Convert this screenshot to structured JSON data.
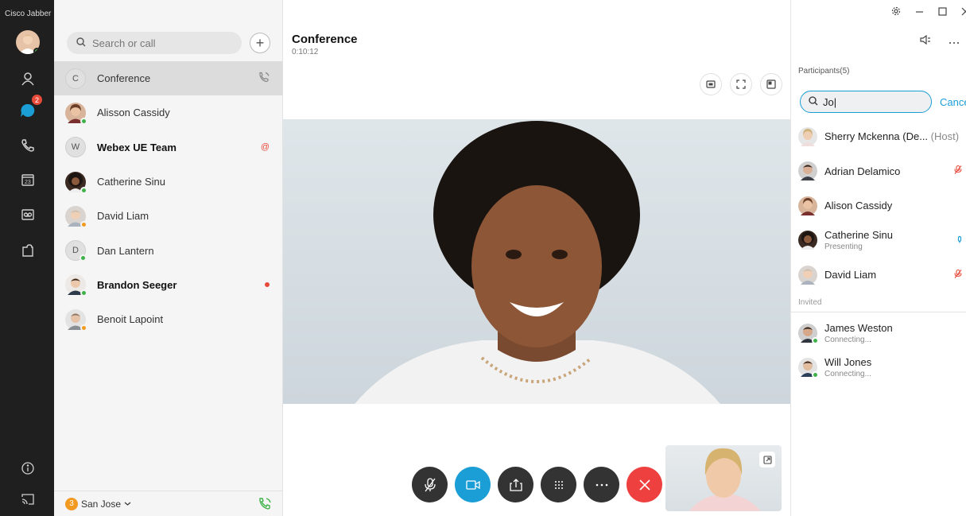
{
  "app": {
    "name": "Cisco Jabber"
  },
  "rail": {
    "chat_badge": "2"
  },
  "contacts": {
    "search_placeholder": "Search or call",
    "items": [
      {
        "name": "Conference",
        "initial": "C",
        "bold": false,
        "trailing": "phone-icon"
      },
      {
        "name": "Alisson Cassidy",
        "initial": "",
        "bold": false,
        "status": "#3fb24a"
      },
      {
        "name": "Webex UE Team",
        "initial": "W",
        "bold": true,
        "trailing": "mention-icon"
      },
      {
        "name": "Catherine Sinu",
        "initial": "",
        "bold": false,
        "status": "#3fb24a"
      },
      {
        "name": "David Liam",
        "initial": "",
        "bold": false,
        "status": "#f29a20"
      },
      {
        "name": "Dan Lantern",
        "initial": "D",
        "bold": false,
        "status": "#3fb24a"
      },
      {
        "name": "Brandon Seeger",
        "initial": "",
        "bold": true,
        "status": "#3fb24a",
        "trailing": "unread-dot"
      },
      {
        "name": "Benoit Lapoint",
        "initial": "",
        "bold": false,
        "status": "#f29a20"
      }
    ],
    "footer": {
      "count": "3",
      "location": "San Jose"
    }
  },
  "call": {
    "title": "Conference",
    "timer": "0:10:12"
  },
  "participants": {
    "header": "Participants(5)",
    "search_value": "Jo|",
    "cancel_label": "Cance",
    "list": [
      {
        "name": "Sherry Mckenna (De...",
        "host": "(Host)",
        "sub": ""
      },
      {
        "name": "Adrian Delamico",
        "host": "",
        "sub": "",
        "trailing": "muted"
      },
      {
        "name": "Alison Cassidy",
        "host": "",
        "sub": ""
      },
      {
        "name": "Catherine Sinu",
        "host": "",
        "sub": "Presenting",
        "trailing": "speaking"
      },
      {
        "name": "David Liam",
        "host": "",
        "sub": "",
        "trailing": "muted"
      }
    ],
    "invited_label": "Invited",
    "invited": [
      {
        "name": "James Weston",
        "sub": "Connecting..."
      },
      {
        "name": "Will Jones",
        "sub": "Connecting..."
      }
    ]
  },
  "colors": {
    "accent": "#1b9ed6",
    "end_call": "#ef4040",
    "available": "#3fb24a",
    "away": "#f29a20",
    "rail": "#1f1f1f"
  }
}
